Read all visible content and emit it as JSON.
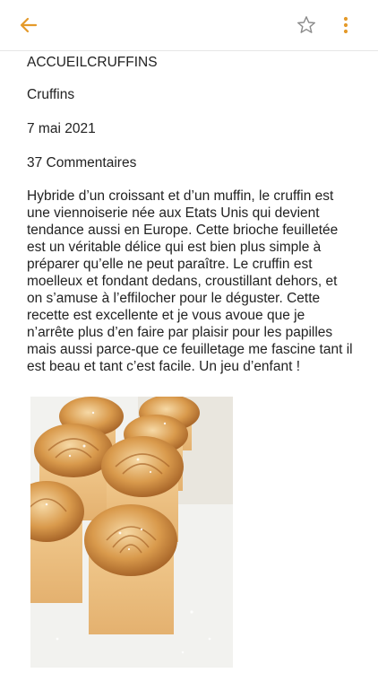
{
  "accent_color": "#E49A2A",
  "appbar": {
    "back_icon": "arrow-left-icon",
    "bookmark_icon": "star-outline-icon",
    "menu_icon": "more-vertical-icon"
  },
  "article": {
    "breadcrumb": "ACCUEILCRUFFINS",
    "title": "Cruffins",
    "date": "7 mai 2021",
    "comments": "37 Commentaires",
    "body": "Hybride d’un croissant et d’un muffin, le cruffin est une viennoiserie née aux Etats Unis qui devient tendance aussi en Europe. Cette brioche feuilletée est un véritable délice qui est bien plus simple à préparer qu’elle ne peut paraître. Le cruffin est moelleux et fondant dedans, croustillant dehors, et on s’amuse à l’effilocher pour le déguster. Cette recette est excellente et je vous avoue que je n’arrête plus d’en faire par plaisir pour les papilles mais aussi parce-que ce feuilletage me fascine tant il est beau et tant c’est facile. Un jeu d’enfant !"
  }
}
